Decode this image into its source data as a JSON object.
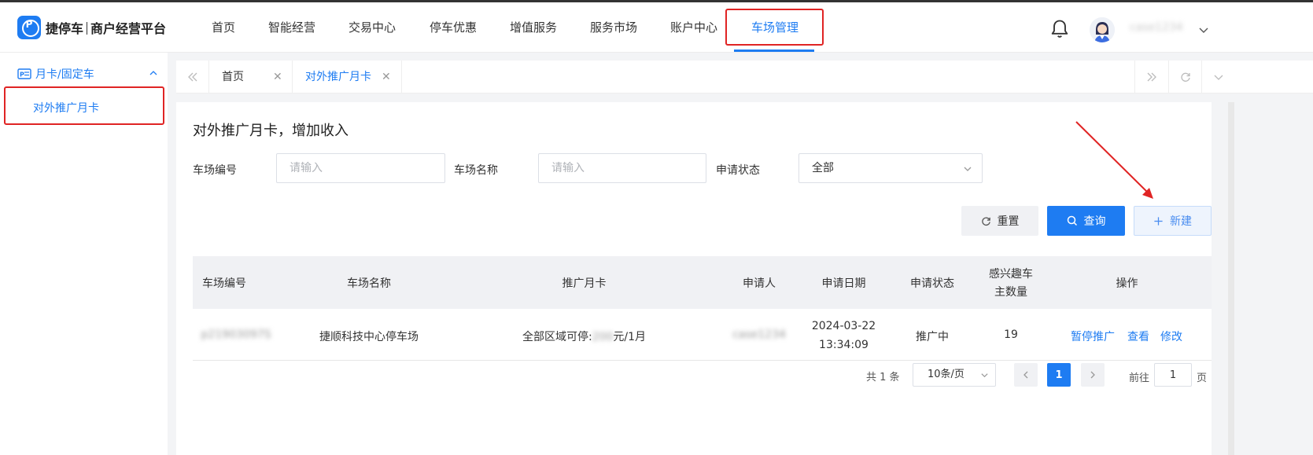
{
  "brand": {
    "name": "捷停车",
    "subtitle": "商户经营平台",
    "logo_glyph": "P"
  },
  "nav": [
    {
      "label": "首页"
    },
    {
      "label": "智能经营"
    },
    {
      "label": "交易中心"
    },
    {
      "label": "停车优惠"
    },
    {
      "label": "增值服务"
    },
    {
      "label": "服务市场"
    },
    {
      "label": "账户中心"
    },
    {
      "label": "车场管理",
      "active": true
    }
  ],
  "user": {
    "name": "case1234"
  },
  "sidebar": {
    "group": {
      "label": "月卡/固定车",
      "icon": "card-icon"
    },
    "items": [
      {
        "label": "对外推广月卡",
        "active": true
      }
    ]
  },
  "tabs": [
    {
      "label": "首页"
    },
    {
      "label": "对外推广月卡",
      "active": true
    }
  ],
  "page": {
    "title": "对外推广月卡，增加收入"
  },
  "filters": {
    "park_code": {
      "label": "车场编号",
      "placeholder": "请输入"
    },
    "park_name": {
      "label": "车场名称",
      "placeholder": "请输入"
    },
    "status": {
      "label": "申请状态",
      "value": "全部"
    }
  },
  "buttons": {
    "reset": "重置",
    "query": "查询",
    "new": "新建"
  },
  "table": {
    "headers": [
      "车场编号",
      "车场名称",
      "推广月卡",
      "申请人",
      "申请日期",
      "申请状态",
      "感兴趣车",
      "主数量",
      "操作"
    ],
    "rows": [
      {
        "code": "p21903097S",
        "name": "捷顺科技中心停车场",
        "card_prefix": "全部区域可停:",
        "card_amount": "200",
        "card_suffix": "元/1月",
        "applicant": "case1234",
        "date": "2024-03-22",
        "time": "13:34:09",
        "status": "推广中",
        "interested": "19",
        "actions": [
          "暂停推广",
          "查看",
          "修改"
        ]
      }
    ]
  },
  "pager": {
    "total": "共 1 条",
    "page_size": "10条/页",
    "current": "1",
    "goto_prefix": "前往",
    "goto_value": "1",
    "goto_suffix": "页"
  },
  "colors": {
    "accent": "#1e7cf2",
    "annotation": "#e02424"
  }
}
